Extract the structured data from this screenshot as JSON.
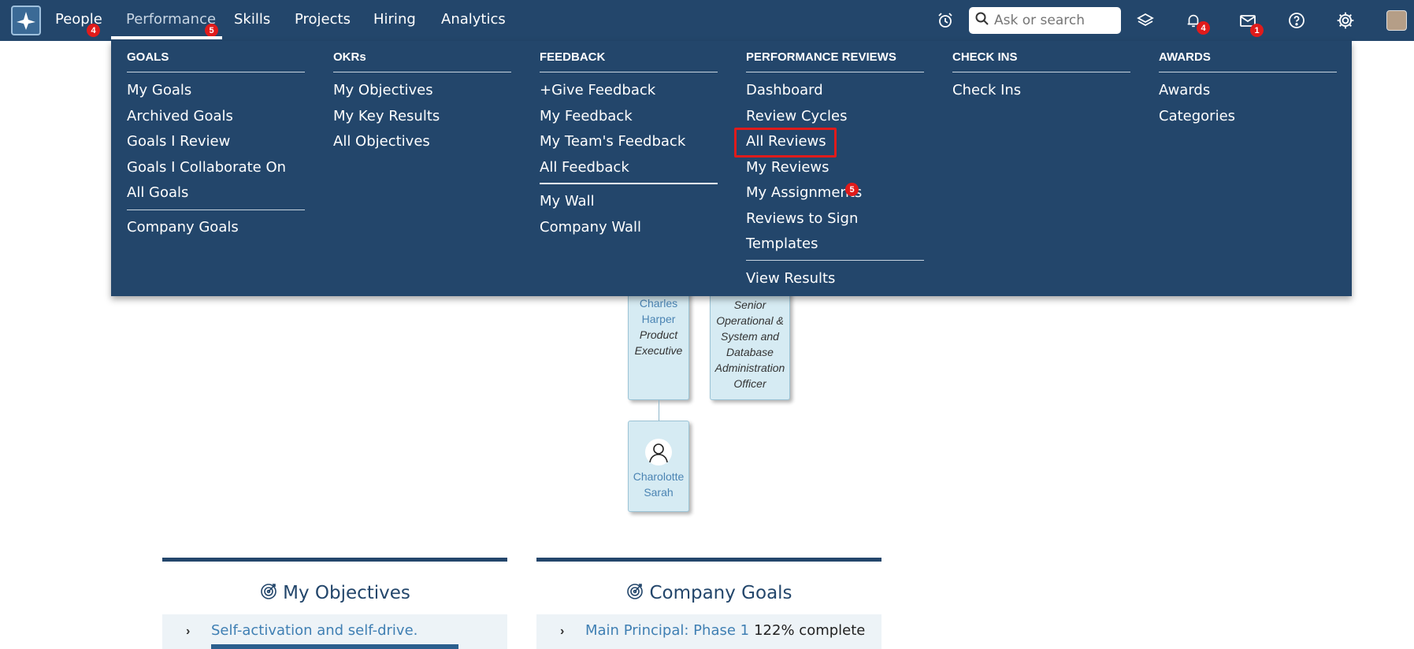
{
  "topbar": {
    "nav": [
      {
        "label": "People",
        "badge": "4"
      },
      {
        "label": "Performance",
        "badge": "5"
      },
      {
        "label": "Skills"
      },
      {
        "label": "Projects"
      },
      {
        "label": "Hiring"
      },
      {
        "label": "Analytics"
      }
    ],
    "search_placeholder": "Ask or search",
    "notifications_badge": "4",
    "messages_badge": "1",
    "icons": [
      "logo-icon",
      "alarm-clock-icon",
      "search-icon",
      "layers-icon",
      "bell-icon",
      "mail-icon",
      "help-icon",
      "gear-icon",
      "avatar"
    ]
  },
  "menu": {
    "goals": {
      "heading": "GOALS",
      "items": [
        "My Goals",
        "Archived Goals",
        "Goals I Review",
        "Goals I Collaborate On",
        "All Goals",
        "Company Goals"
      ]
    },
    "okrs": {
      "heading": "OKRs",
      "items": [
        "My Objectives",
        "My Key Results",
        "All Objectives"
      ]
    },
    "feedback": {
      "heading": "FEEDBACK",
      "items": [
        "+Give Feedback",
        "My Feedback",
        "My Team's Feedback",
        "All Feedback",
        "My Wall",
        "Company Wall"
      ]
    },
    "reviews": {
      "heading": "PERFORMANCE REVIEWS",
      "items": [
        "Dashboard",
        "Review Cycles",
        "All Reviews",
        "My Reviews",
        "My Assignments",
        "Reviews to Sign",
        "Templates",
        "View Results"
      ],
      "assignments_badge": "5",
      "highlighted": "All Reviews"
    },
    "checkins": {
      "heading": "CHECK INS",
      "items": [
        "Check Ins"
      ]
    },
    "awards": {
      "heading": "AWARDS",
      "items": [
        "Awards",
        "Categories"
      ]
    }
  },
  "org_chart": {
    "node1": {
      "name_line1": "Charles",
      "name_line2": "Harper",
      "title_line1": "Product",
      "title_line2": "Executive"
    },
    "node2": {
      "title_line1": "Senior",
      "title_line2": "Operational &",
      "title_line3": "System and",
      "title_line4": "Database",
      "title_line5": "Administration",
      "title_line6": "Officer"
    },
    "node3": {
      "name_line1": "Charolotte",
      "name_line2": "Sarah"
    }
  },
  "widgets": {
    "objectives": {
      "title": "My Objectives",
      "row_label": "Self-activation and self-drive."
    },
    "company_goals": {
      "title": "Company Goals",
      "row_label": "Main Principal: Phase 1",
      "row_status": "122% complete"
    }
  },
  "colors": {
    "navy": "#23466b",
    "badge_red": "#e01b1b",
    "org_node": "#d6ebf3",
    "link_blue": "#3f7fb3"
  }
}
